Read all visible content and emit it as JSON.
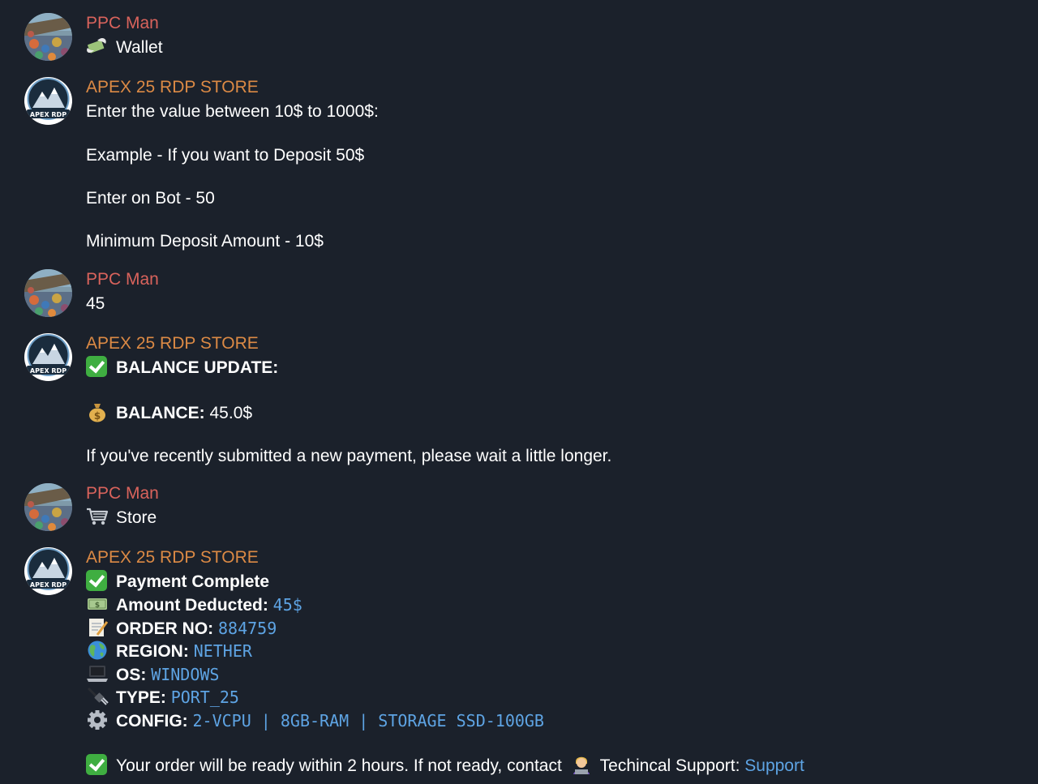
{
  "messages": [
    {
      "sender": "PPC Man",
      "text": "Wallet",
      "icon": "money-wings-icon"
    },
    {
      "sender": "APEX 25 RDP STORE",
      "lines": [
        "Enter the value between 10$ to 1000$:",
        "Example - If you want to Deposit 50$",
        "Enter on Bot - 50",
        "Minimum Deposit Amount - 10$"
      ],
      "avatar_text": "APEX RDP"
    },
    {
      "sender": "PPC Man",
      "text": "45"
    },
    {
      "sender": "APEX 25 RDP STORE",
      "balance_update_label": "BALANCE UPDATE:",
      "balance_label": "BALANCE:",
      "balance_value": "45.0$",
      "note": "If you've recently submitted a new payment, please wait a little longer.",
      "avatar_text": "APEX RDP"
    },
    {
      "sender": "PPC Man",
      "text": "Store",
      "icon": "shopping-cart-icon"
    },
    {
      "sender": "APEX 25 RDP STORE",
      "avatar_text": "APEX RDP",
      "payment_complete": "Payment Complete",
      "fields": [
        {
          "label": "Amount Deducted:",
          "value": "45$",
          "icon": "dollar-bill-icon"
        },
        {
          "label": "ORDER NO:",
          "value": "884759",
          "icon": "memo-icon"
        },
        {
          "label": "REGION:",
          "value": "NETHER",
          "icon": "globe-icon"
        },
        {
          "label": "OS:",
          "value": "WINDOWS",
          "icon": "laptop-icon"
        },
        {
          "label": "TYPE:",
          "value": "PORT_25",
          "icon": "plug-icon"
        },
        {
          "label": "CONFIG:",
          "value": "2-VCPU | 8GB-RAM | STORAGE SSD-100GB",
          "icon": "gear-icon"
        }
      ],
      "ready_text": "Your order will be ready within 2 hours. If not ready, contact",
      "support_label": "Techincal Support:",
      "support_link": "Support"
    }
  ],
  "colors": {
    "background": "#1b212b",
    "user_name": "#d9635c",
    "bot_name": "#dc8a45",
    "value": "#5ea4e4",
    "check": "#3fae41"
  }
}
